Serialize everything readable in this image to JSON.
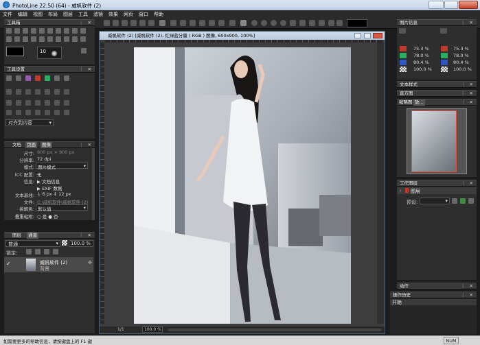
{
  "app": {
    "title": "PhotoLine 22.50 (64) - 威帆软件 (2)"
  },
  "menu": [
    "文件",
    "编辑",
    "视图",
    "布局",
    "图层",
    "工具",
    "滤镜",
    "效果",
    "网页",
    "窗口",
    "帮助"
  ],
  "left": {
    "tools_title": "工具箱",
    "tool_size": "10",
    "settings_title": "工具设置",
    "align_dropdown": "对齐到内容",
    "doc_tabs": [
      "文档",
      "页面",
      "图像"
    ],
    "doc_rows": [
      {
        "label": "尺寸:",
        "value": "600 px × 900 px",
        "dim": true
      },
      {
        "label": "分辨率:",
        "value": "72 dpi"
      },
      {
        "label": "模式:",
        "value": "图片模式"
      },
      {
        "label": "ICC 配置:",
        "value": "无"
      },
      {
        "label": "信息:",
        "value": "▶ 文档信息"
      },
      {
        "label": "",
        "value": "▶ EXIF 数据"
      },
      {
        "label": "文本基线:",
        "value": "↓ 6 px     ↕ 12 px"
      },
      {
        "label": "文件:",
        "value": "C:\\威帆软件\\威帆软件 (2)",
        "dim": true
      },
      {
        "label": "拆解色:",
        "value": "默认值"
      },
      {
        "label": "叠重粘附:",
        "value": "○ 是        ● 否"
      }
    ],
    "layers_tabs": [
      "图层",
      "通道"
    ],
    "blend_mode": "普通",
    "opacity": "100.0 %",
    "lock_label": "锁定:",
    "layer_name": "威帆软件 (2)",
    "layer_sub": "背景"
  },
  "document": {
    "title": "威帆软件 (2) [威帆软件 (2), 红绿蓝分量 ( RGB ) 图像, 600x900, 100%]",
    "page": "1/1",
    "zoom": "100.0 %"
  },
  "right": {
    "info_title": "图片信息",
    "info_rows": [
      {
        "color": "#c0392b",
        "v1": "75.3 %",
        "v2": "75.3 %"
      },
      {
        "color": "#27ae60",
        "v1": "78.0 %",
        "v2": "78.0 %"
      },
      {
        "color": "#2e56c4",
        "v1": "80.4 %",
        "v2": "80.4 %"
      },
      {
        "color": "checker",
        "v1": "100.0 %",
        "v2": "100.0 %"
      }
    ],
    "text_style_title": "文本样式",
    "histogram_title": "直方图",
    "thumbnail_tabs": [
      "缩略图",
      "放..."
    ],
    "work_layer_title": "工作图层",
    "work_layer_item": "图层",
    "preset_label": "预设:",
    "actions_title": "动作",
    "history_title": "操作历史",
    "history_item": "开始"
  },
  "status": {
    "help": "如需要更多的帮助信息，请按键盘上的 F1 键",
    "num": "NUM"
  }
}
